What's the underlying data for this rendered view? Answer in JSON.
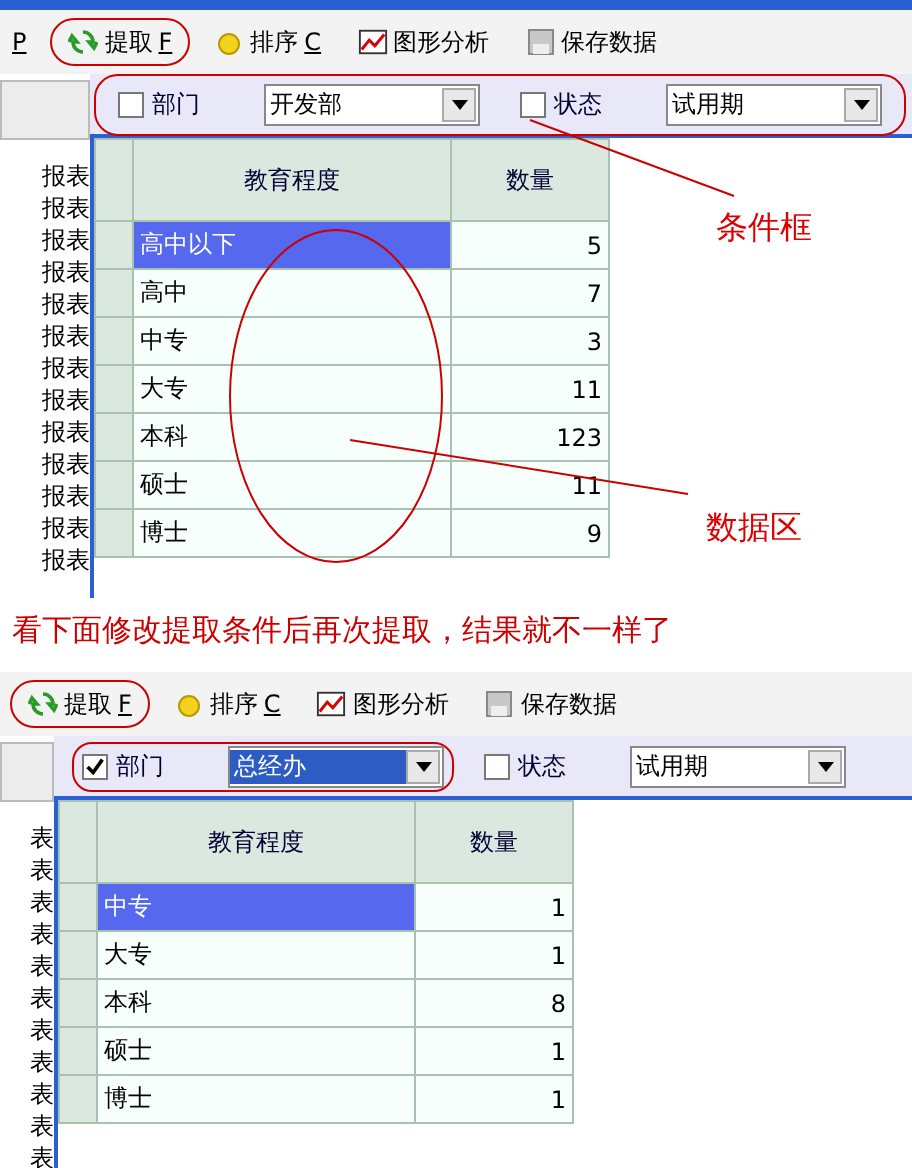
{
  "panels": [
    {
      "toolbar": [
        {
          "kind": "none",
          "mnemonic": "P",
          "highlighted": false
        },
        {
          "kind": "refresh",
          "label": "提取",
          "mnemonic": "F",
          "highlighted": true
        },
        {
          "kind": "sort",
          "label": "排序",
          "mnemonic": "C",
          "highlighted": false
        },
        {
          "kind": "chart",
          "label": "图形分析",
          "highlighted": false
        },
        {
          "kind": "save",
          "label": "保存数据",
          "highlighted": false
        }
      ],
      "conditions_highlighted": true,
      "conditions": [
        {
          "checked": false,
          "label": "部门",
          "value": "开发部",
          "value_selected": false,
          "highlighted": false
        },
        {
          "checked": false,
          "label": "状态",
          "value": "试用期",
          "value_selected": false,
          "highlighted": false
        }
      ],
      "sidebar_items": [
        "报表",
        "报表",
        "报表",
        "报表",
        "报表",
        "报表",
        "报表",
        "报表",
        "报表",
        "报表",
        "报表",
        "报表",
        "报表"
      ],
      "table": {
        "columns": [
          "教育程度",
          "数量"
        ],
        "rows": [
          {
            "cells": [
              "高中以下",
              "5"
            ],
            "selected": true
          },
          {
            "cells": [
              "高中",
              "7"
            ],
            "selected": false
          },
          {
            "cells": [
              "中专",
              "3"
            ],
            "selected": false
          },
          {
            "cells": [
              "大专",
              "11"
            ],
            "selected": false
          },
          {
            "cells": [
              "本科",
              "123"
            ],
            "selected": false
          },
          {
            "cells": [
              "硕士",
              "11"
            ],
            "selected": false
          },
          {
            "cells": [
              "博士",
              "9"
            ],
            "selected": false
          }
        ]
      },
      "callouts": [
        {
          "text": "条件框"
        },
        {
          "text": "数据区"
        }
      ]
    },
    {
      "toolbar": [
        {
          "kind": "refresh",
          "label": "提取",
          "mnemonic": "F",
          "highlighted": true
        },
        {
          "kind": "sort",
          "label": "排序",
          "mnemonic": "C",
          "highlighted": false
        },
        {
          "kind": "chart",
          "label": "图形分析",
          "highlighted": false
        },
        {
          "kind": "save",
          "label": "保存数据",
          "highlighted": false
        }
      ],
      "conditions_highlighted": false,
      "conditions": [
        {
          "checked": true,
          "label": "部门",
          "value": "总经办",
          "value_selected": true,
          "highlighted": true
        },
        {
          "checked": false,
          "label": "状态",
          "value": "试用期",
          "value_selected": false,
          "highlighted": false
        }
      ],
      "sidebar_items": [
        "表",
        "表",
        "表",
        "表",
        "表",
        "表",
        "表",
        "表",
        "表",
        "表",
        "表"
      ],
      "table": {
        "columns": [
          "教育程度",
          "数量"
        ],
        "rows": [
          {
            "cells": [
              "中专",
              "1"
            ],
            "selected": true
          },
          {
            "cells": [
              "大专",
              "1"
            ],
            "selected": false
          },
          {
            "cells": [
              "本科",
              "8"
            ],
            "selected": false
          },
          {
            "cells": [
              "硕士",
              "1"
            ],
            "selected": false
          },
          {
            "cells": [
              "博士",
              "1"
            ],
            "selected": false
          }
        ]
      }
    }
  ],
  "caption": "看下面修改提取条件后再次提取，结果就不一样了"
}
